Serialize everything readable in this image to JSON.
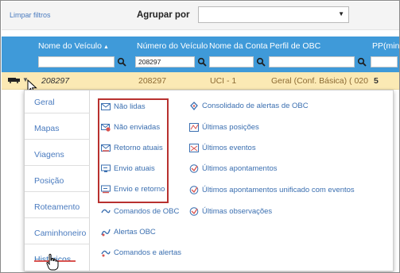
{
  "toolbar": {
    "clear_filters": "Limpar filtros",
    "group_by_label": "Agrupar por",
    "group_by_value": ""
  },
  "table": {
    "headers": [
      "Nome do Veículo",
      "Número do Veículo",
      "Nome da Conta",
      "Perfil de OBC",
      "PP(min)"
    ],
    "filters": [
      "",
      "208297",
      "",
      "",
      ""
    ],
    "row": {
      "name": "208297",
      "number": "208297",
      "account": "UCI - 1",
      "obc_profile": "Geral (Conf. Básica) ( 020",
      "pp": "5"
    }
  },
  "menu": {
    "side_items": [
      "Geral",
      "Mapas",
      "Viagens",
      "Posição",
      "Roteamento",
      "Caminhoneiro",
      "Históricos"
    ],
    "active_item": "Históricos",
    "col1": [
      {
        "label": "Não lidas",
        "icon": "envelope-icon"
      },
      {
        "label": "Não enviadas",
        "icon": "envelope-x-icon"
      },
      {
        "label": "Retorno atuais",
        "icon": "envelope-return-icon"
      },
      {
        "label": "Envio atuais",
        "icon": "monitor-send-icon"
      },
      {
        "label": "Envio e retorno",
        "icon": "send-return-icon"
      },
      {
        "label": "Comandos de OBC",
        "icon": "command-icon"
      },
      {
        "label": "Alertas OBC",
        "icon": "alert-icon"
      },
      {
        "label": "Comandos e alertas",
        "icon": "command-alert-icon"
      }
    ],
    "col2": [
      {
        "label": "Consolidado de alertas de OBC",
        "icon": "alerts-consolidated-icon"
      },
      {
        "label": "Últimas posições",
        "icon": "positions-icon"
      },
      {
        "label": "Últimos eventos",
        "icon": "events-icon"
      },
      {
        "label": "Últimos apontamentos",
        "icon": "notes-icon"
      },
      {
        "label": "Últimos apontamentos unificado com eventos",
        "icon": "notes-events-icon"
      },
      {
        "label": "Últimas observações",
        "icon": "observations-icon"
      }
    ]
  },
  "colors": {
    "header_blue": "#3f9ad9",
    "row_highlight": "#fbe9b4",
    "link_blue": "#3b6fb0",
    "highlight_red": "#b8312f"
  }
}
